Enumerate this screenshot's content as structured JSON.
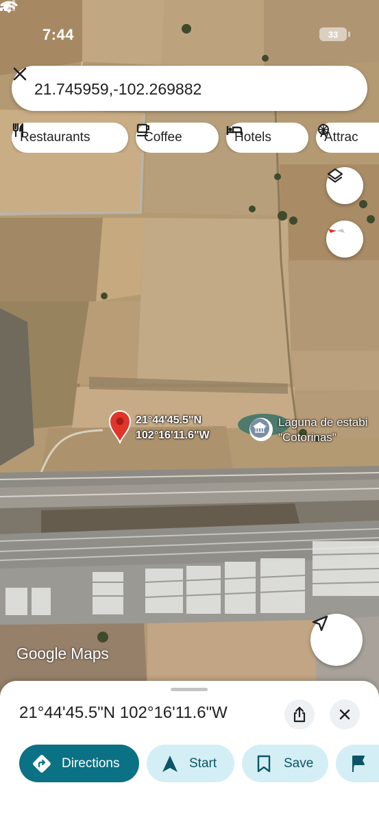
{
  "status_bar": {
    "time": "7:44",
    "battery": "33"
  },
  "search": {
    "query": "21.745959,-102.269882"
  },
  "chips": [
    {
      "label": "Restaurants",
      "icon": "fork-knife-icon"
    },
    {
      "label": "Coffee",
      "icon": "coffee-cup-icon"
    },
    {
      "label": "Hotels",
      "icon": "bed-icon"
    },
    {
      "label": "Attrac",
      "icon": "ferris-wheel-icon"
    }
  ],
  "map": {
    "pin_label_line1": "21°44'45.5\"N",
    "pin_label_line2": "102°16'11.6\"W",
    "poi_line1": "Laguna de estabi",
    "poi_line2": "\"Cotorinas\"",
    "poi_icon": "museum-icon",
    "watermark": "Google Maps",
    "pin_color": "#e1352b"
  },
  "sheet": {
    "title": "21°44'45.5\"N 102°16'11.6\"W",
    "actions": [
      {
        "label": "Directions",
        "icon": "directions-icon"
      },
      {
        "label": "Start",
        "icon": "navigation-arrow-icon"
      },
      {
        "label": "Save",
        "icon": "bookmark-icon"
      },
      {
        "label": "",
        "icon": "flag-icon"
      }
    ]
  },
  "colors": {
    "primary": "#0b7185",
    "secondary_bg": "#d4eef5",
    "secondary_text": "#0b5566"
  }
}
